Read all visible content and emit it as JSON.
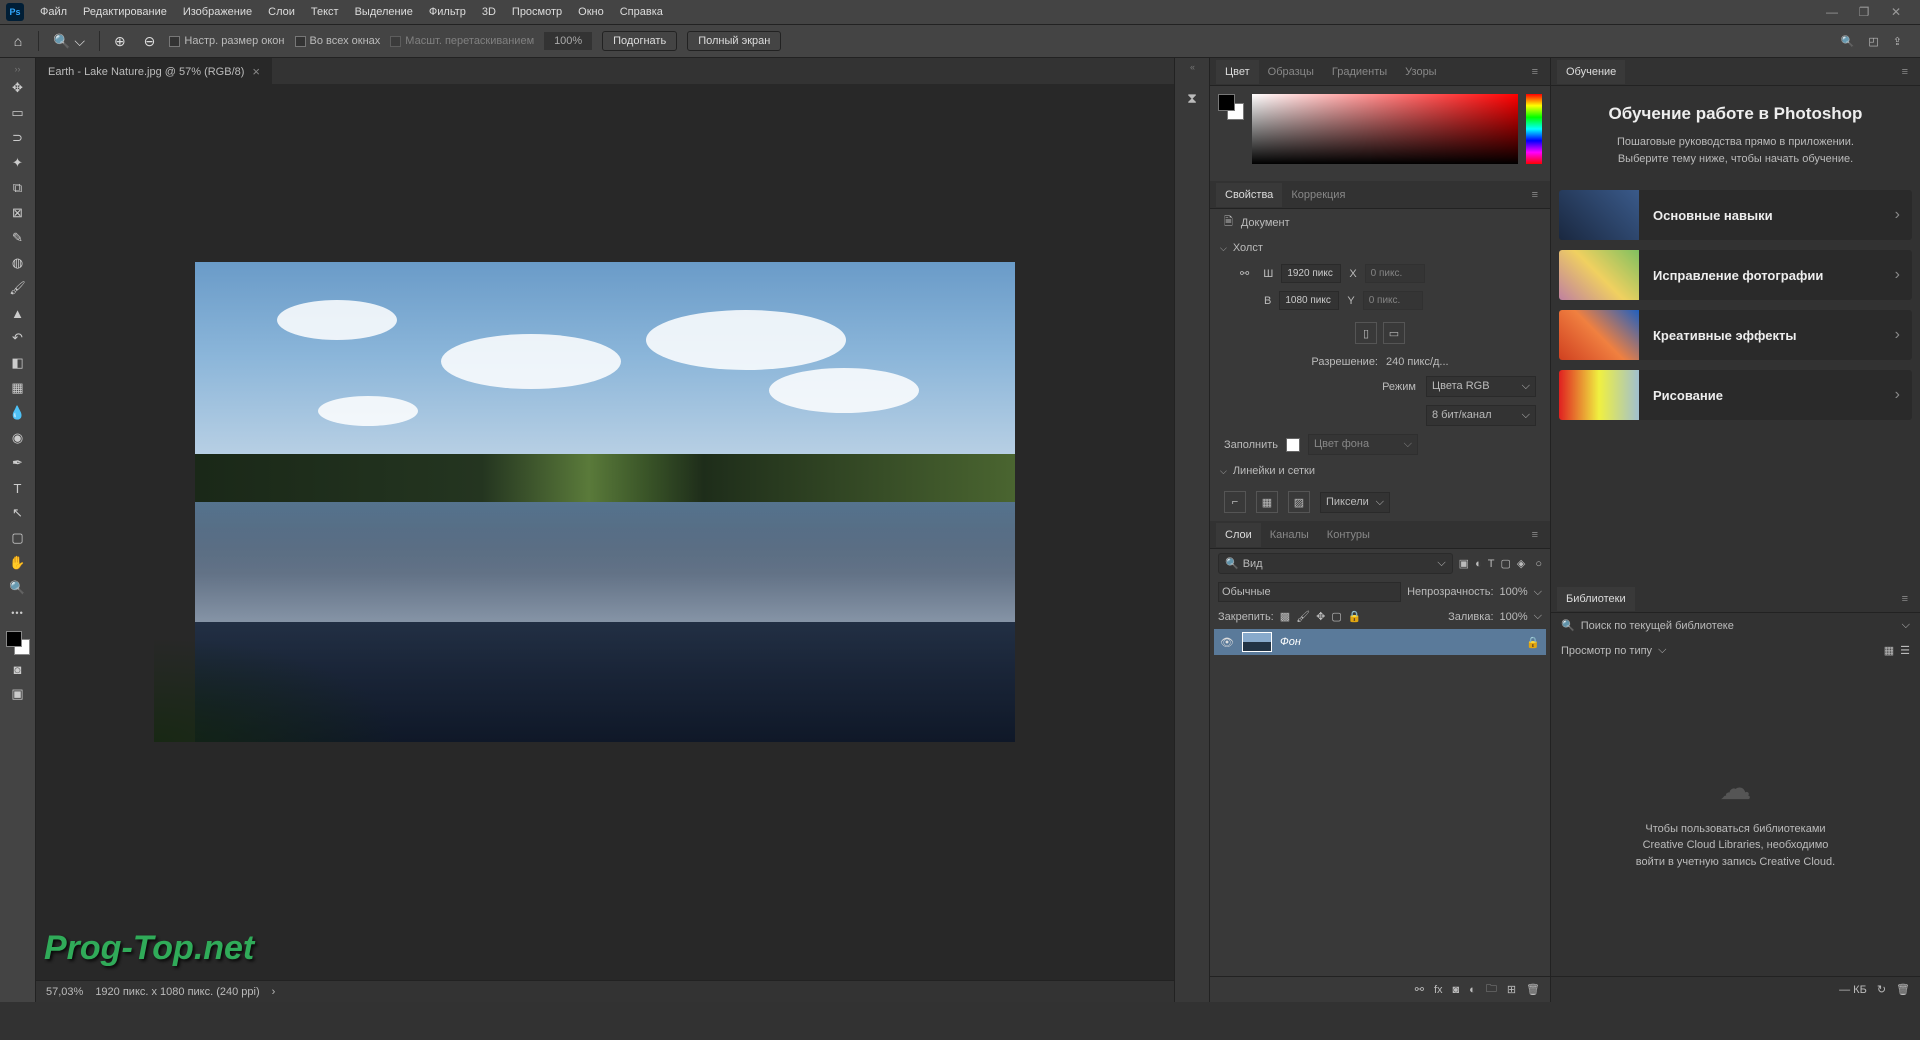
{
  "menu": {
    "items": [
      "Файл",
      "Редактирование",
      "Изображение",
      "Слои",
      "Текст",
      "Выделение",
      "Фильтр",
      "3D",
      "Просмотр",
      "Окно",
      "Справка"
    ]
  },
  "optbar": {
    "resize": "Настр. размер окон",
    "allwin": "Во всех окнах",
    "scrub": "Масшт. перетаскиванием",
    "zoom": "100%",
    "fit": "Подогнать",
    "full": "Полный экран"
  },
  "tab": {
    "name": "Earth - Lake Nature.jpg @ 57% (RGB/8)"
  },
  "status": {
    "zoom": "57,03%",
    "info": "1920 пикс. x 1080 пикс. (240 ppi)"
  },
  "colorTabs": [
    "Цвет",
    "Образцы",
    "Градиенты",
    "Узоры"
  ],
  "propsTabs": [
    "Свойства",
    "Коррекция"
  ],
  "props": {
    "doc": "Документ",
    "canvas": "Холст",
    "w": "Ш",
    "wval": "1920 пикс",
    "x": "X",
    "xval": "0 пикс.",
    "h": "В",
    "hval": "1080 пикс",
    "y": "Y",
    "yval": "0 пикс.",
    "res": "Разрешение:",
    "resval": "240 пикс/д...",
    "mode": "Режим",
    "modeval": "Цвета RGB",
    "depth": "8 бит/канал",
    "fill": "Заполнить",
    "fillval": "Цвет фона",
    "rulers": "Линейки и сетки",
    "units": "Пиксели"
  },
  "layersTabs": [
    "Слои",
    "Каналы",
    "Контуры"
  ],
  "layers": {
    "kind": "Вид",
    "blend": "Обычные",
    "opac": "Непрозрачность:",
    "opacval": "100%",
    "lock": "Закрепить:",
    "fill": "Заливка:",
    "fillval": "100%",
    "bg": "Фон"
  },
  "learnTab": "Обучение",
  "learn": {
    "title": "Обучение работе в Photoshop",
    "sub1": "Пошаговые руководства прямо в приложении.",
    "sub2": "Выберите тему ниже, чтобы начать обучение.",
    "items": [
      "Основные навыки",
      "Исправление фотографии",
      "Креативные эффекты",
      "Рисование"
    ]
  },
  "libTab": "Библиотеки",
  "lib": {
    "search": "Поиск по текущей библиотеке",
    "view": "Просмотр по типу",
    "msg1": "Чтобы пользоваться библиотеками",
    "msg2": "Creative Cloud Libraries, необходимо",
    "msg3": "войти в учетную запись Creative Cloud.",
    "size": "— КБ"
  },
  "watermark": "Prog-Top.net"
}
